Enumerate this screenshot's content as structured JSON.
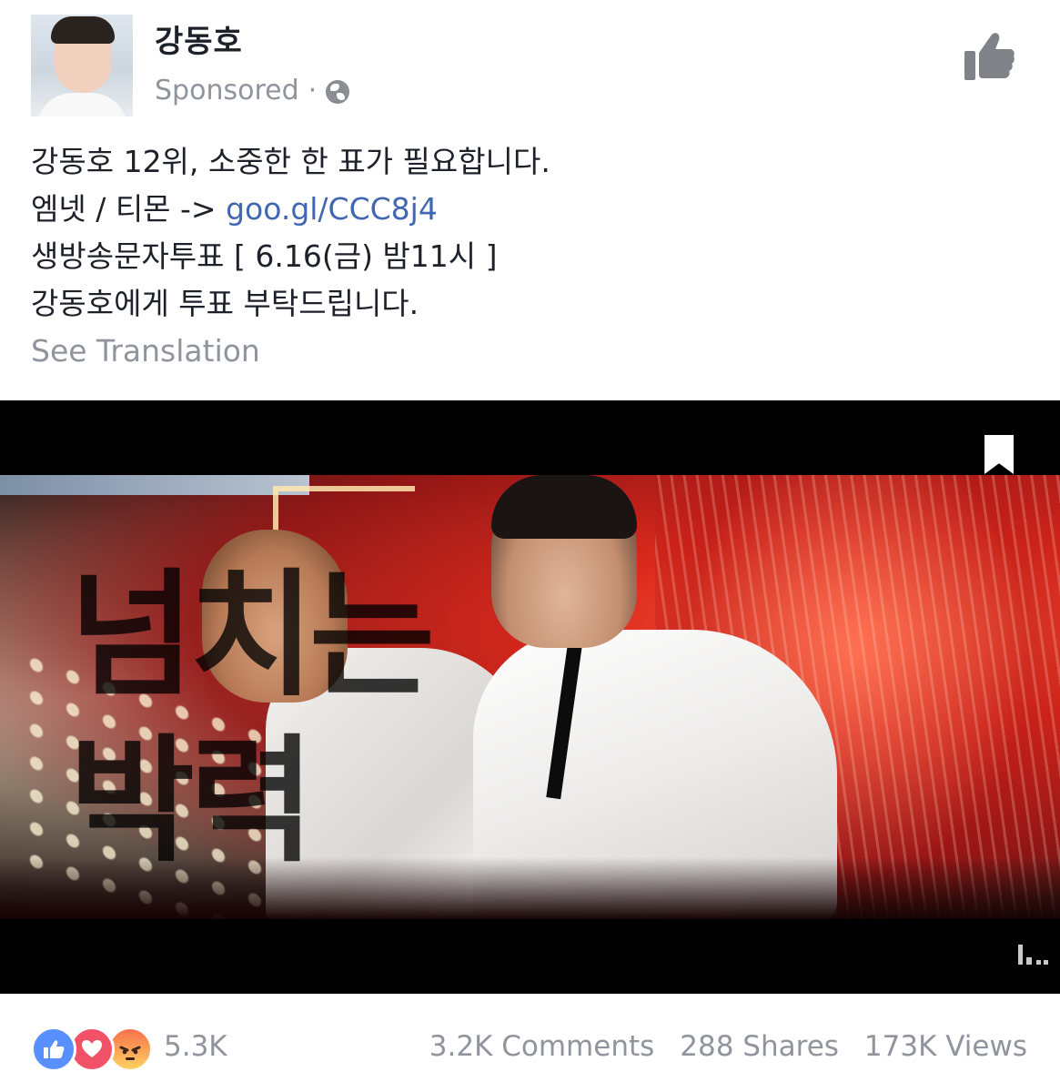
{
  "post": {
    "author": "강동호",
    "sponsored_label": "Sponsored",
    "separator": "·",
    "privacy_icon": "globe-icon",
    "header_action_icon": "thumbs-up-icon",
    "text_lines": [
      "강동호 12위, 소중한 한 표가 필요합니다.",
      "엠넷 / 티몬 -> ",
      "생방송문자투표 [ 6.16(금) 밤11시 ]",
      "강동호에게 투표 부탁드립니다."
    ],
    "link": "goo.gl/CCC8j4",
    "see_translation": "See Translation"
  },
  "video": {
    "overlay_line1": "넘치는",
    "overlay_line2": "박력",
    "bookmark_icon": "bookmark-icon",
    "stats_icon": "bar-chart-icon"
  },
  "footer": {
    "reaction_icons": [
      "like-reaction-icon",
      "love-reaction-icon",
      "angry-reaction-icon"
    ],
    "reactions_count": "5.3K",
    "comments": "3.2K Comments",
    "shares": "288 Shares",
    "views": "173K Views"
  },
  "colors": {
    "link": "#4267b2",
    "muted": "#90949c",
    "text": "#1d2129",
    "like": "#5890ff",
    "love": "#f25268",
    "angry_top": "#f7714c",
    "angry_bottom": "#fdd262"
  }
}
